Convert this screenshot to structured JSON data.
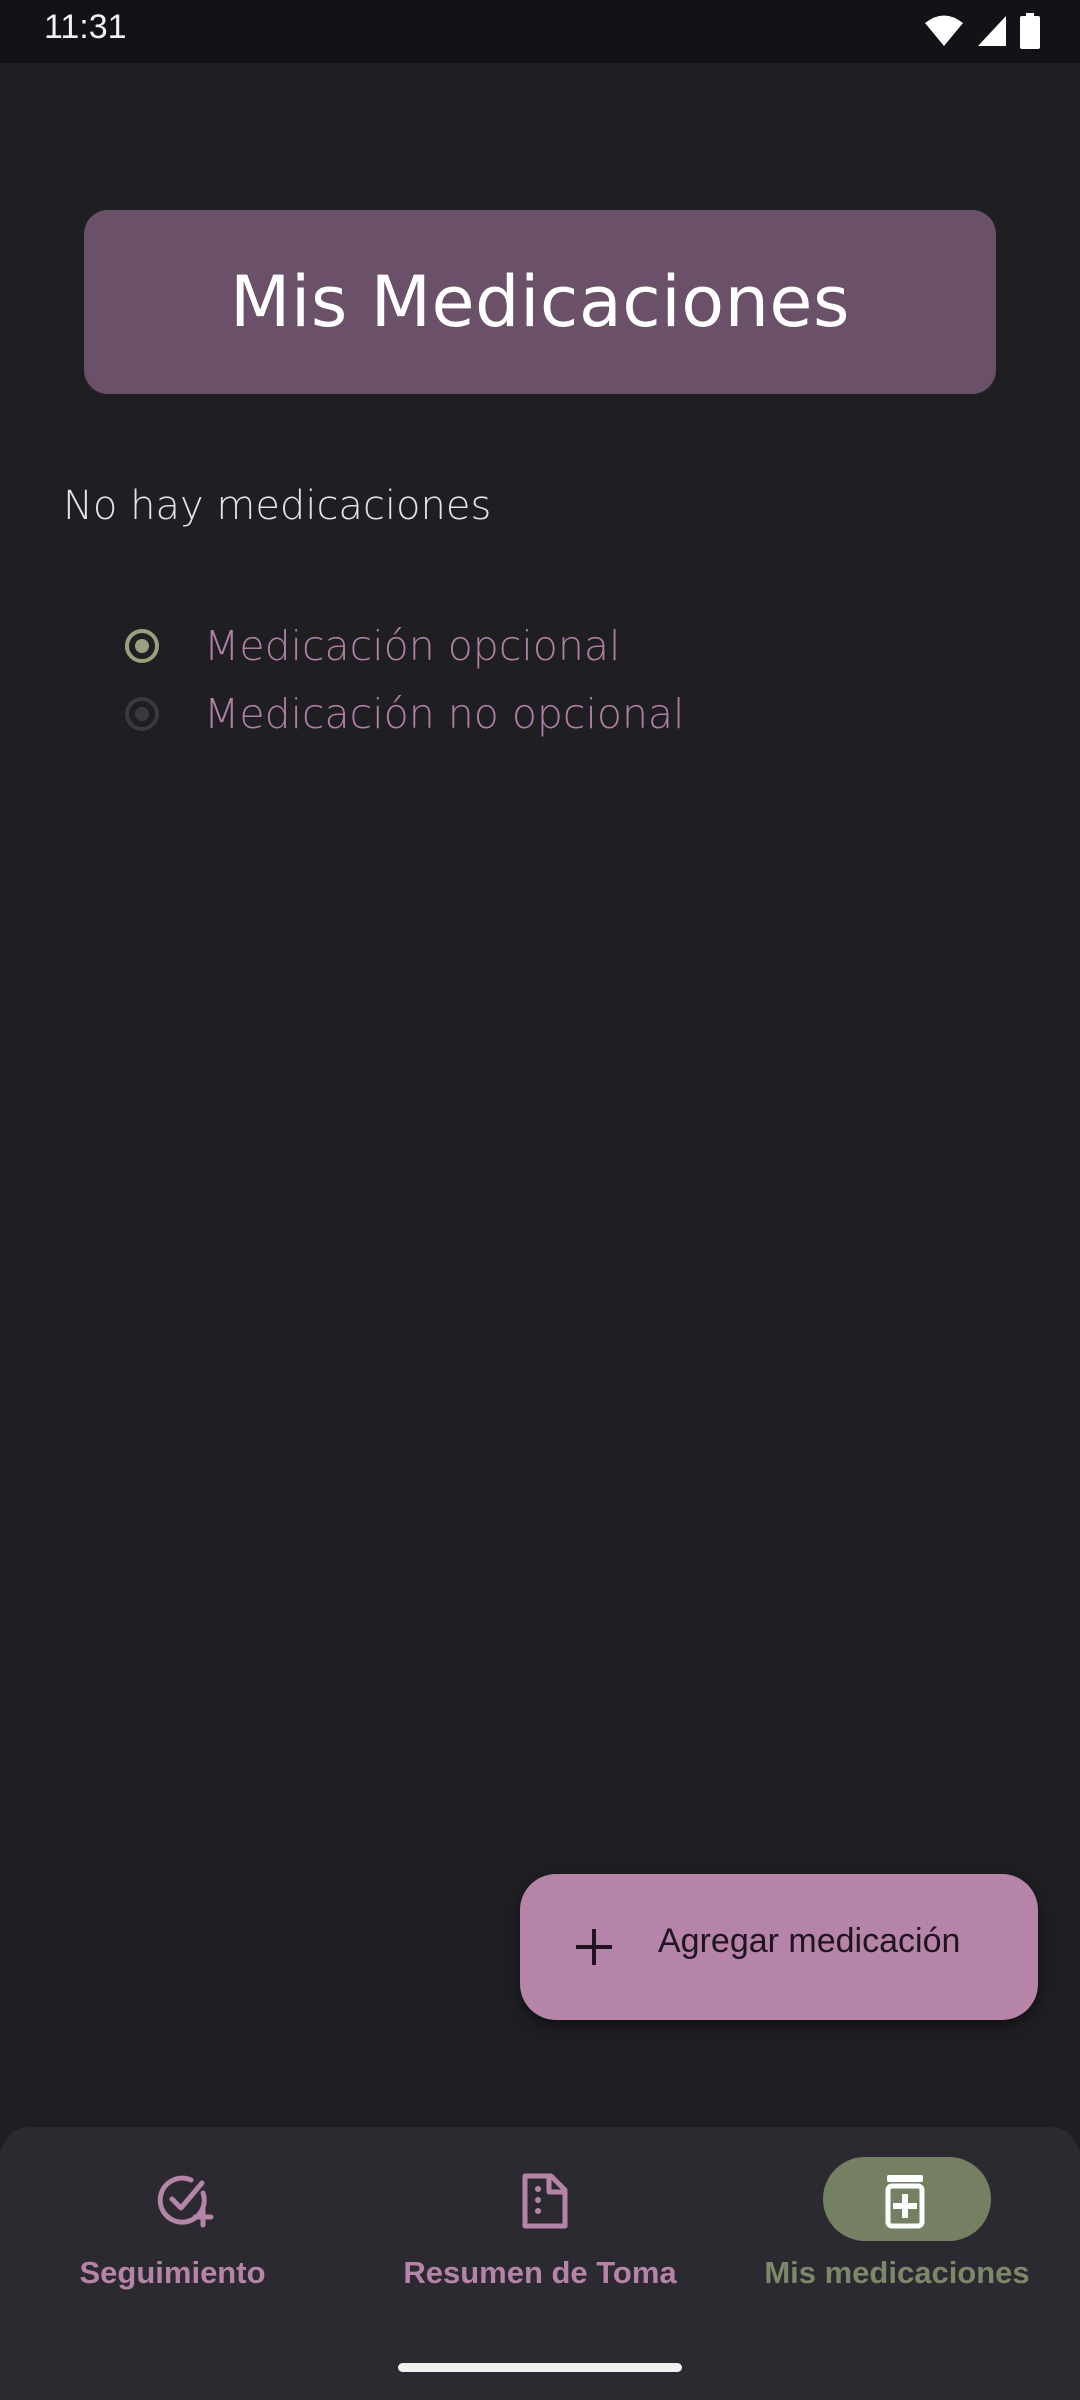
{
  "status_bar": {
    "time": "11:31",
    "icons": [
      "wifi-icon",
      "signal-icon",
      "battery-icon"
    ]
  },
  "header": {
    "title": "Mis Medicaciones"
  },
  "main": {
    "empty_message": "No hay medicaciones",
    "filters": [
      {
        "label": "Medicación opcional",
        "selected": true
      },
      {
        "label": "Medicación no opcional",
        "selected": false
      }
    ]
  },
  "fab": {
    "label": "Agregar medicación",
    "icon": "plus-icon"
  },
  "bottom_nav": {
    "items": [
      {
        "label": "Seguimiento",
        "icon": "check-circle-add-icon",
        "active": false
      },
      {
        "label": "Resumen de Toma",
        "icon": "document-icon",
        "active": false
      },
      {
        "label": "Mis medicaciones",
        "icon": "medication-bottle-icon",
        "active": true
      }
    ]
  },
  "colors": {
    "background": "#1f1e23",
    "title_card": "#6a5068",
    "accent_pink": "#b684a8",
    "accent_green": "#758063"
  }
}
